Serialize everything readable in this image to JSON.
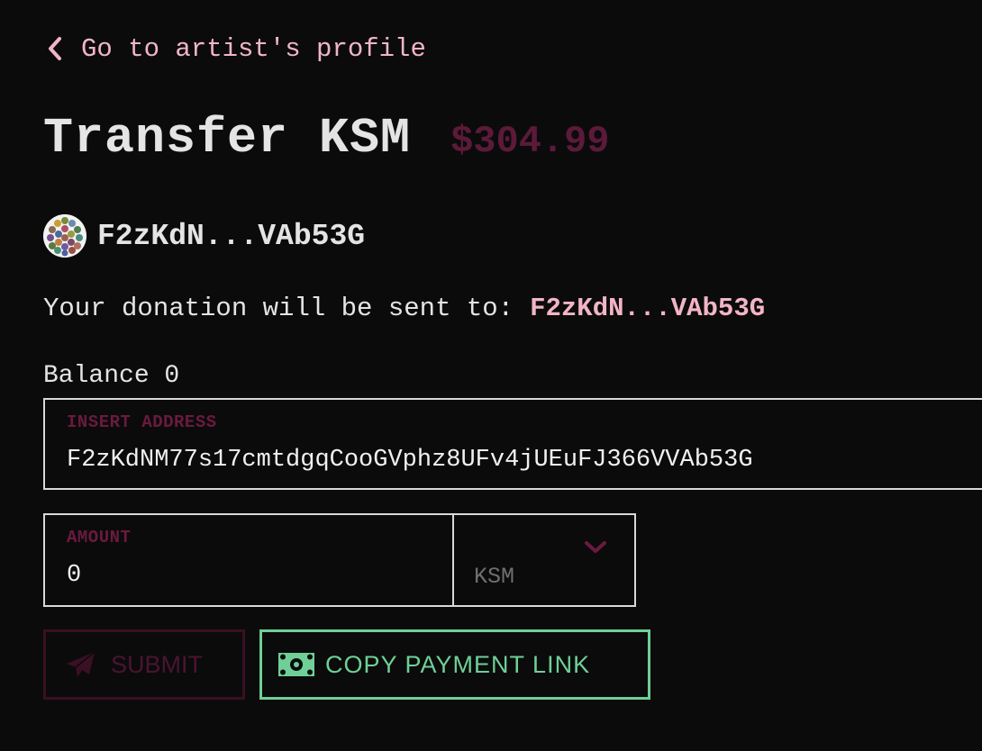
{
  "back_link": {
    "label": "Go to artist's profile"
  },
  "header": {
    "title": "Transfer KSM",
    "price": "$304.99"
  },
  "account": {
    "name": "F2zKdN...VAb53G"
  },
  "donation": {
    "prefix": "Your donation will be sent to:",
    "recipient": "F2zKdN...VAb53G"
  },
  "balance": {
    "text": "Balance 0"
  },
  "address_field": {
    "label": "INSERT ADDRESS",
    "value": "F2zKdNM77s17cmtdgqCooGVphz8UFv4jUEuFJ366VVAb53G"
  },
  "amount_field": {
    "label": "AMOUNT",
    "value": "0"
  },
  "currency": {
    "selected": "KSM"
  },
  "buttons": {
    "submit": "SUBMIT",
    "copy_link": "COPY PAYMENT LINK"
  },
  "icons": {
    "back": "chevron-left-icon",
    "avatar": "identicon",
    "dropdown": "chevron-down-icon",
    "submit": "paper-plane-icon",
    "copy": "money-bill-icon"
  },
  "colors": {
    "background": "#0b0b0b",
    "accent_pink": "#f2b5c6",
    "price": "#5c1a3a",
    "label": "#6a1a3f",
    "copy_green": "#6fcf97"
  }
}
